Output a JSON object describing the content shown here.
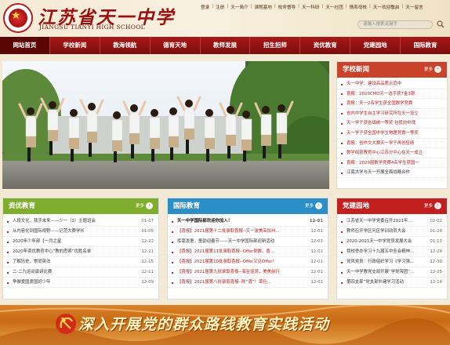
{
  "header": {
    "school_name_cn": "江苏省天一中学",
    "school_name_en": "JIANGSU TIANYI HIGH SCHOOL",
    "top_links": [
      "登录",
      "注册",
      "天一简介",
      "课程基地",
      "校务督导",
      "天一科研",
      "天一社团",
      "情系母校",
      "天一欢迎敬启",
      "天一留言"
    ],
    "search_placeholder": "请输入搜索关键字"
  },
  "nav": {
    "items": [
      "网站首页",
      "学校新闻",
      "教海领航",
      "德育天地",
      "教师发展",
      "招生招师",
      "资优教育",
      "党建园地",
      "国际教育"
    ],
    "active_index": 0
  },
  "slider": {
    "total_dots": 5,
    "active_dot": 4
  },
  "news": {
    "title": "学校新闻",
    "more": "更多",
    "items": [
      "天一中学：建设高品质示范中",
      "喜报：2020CMO天一选手获7金3银",
      "喜报：天一2名学生获全国数学竞赛",
      "省内中学生自主学习研究所在天一设立",
      "天一学子获省级统一等奖 包揽向中瑰",
      "天一学子获全国中学生物理竞赛一等奖",
      "喜报：省作文大赛天一学子再创佳绩",
      "数学组获教育中心江苏分中心在天一成立",
      "喜报：2020届数学竞赛4名学生获国一",
      "江南大学与天一开展全面战略合作"
    ]
  },
  "gifted": {
    "title": "资优教育",
    "more": "更多",
    "items": [
      {
        "text": "人段文化，我手未来——少一（3）主题班会",
        "date": "01-07"
      },
      {
        "text": "从内容化到国际视野——记范大赛学长",
        "date": "01-05"
      },
      {
        "text": "2020年少年部【一月之星",
        "date": "12-22"
      },
      {
        "text": "2020年资优教育中心“教的思索”优胜名单",
        "date": "12-21"
      },
      {
        "text": "了解历史，崇尚英法",
        "date": "12-15"
      },
      {
        "text": "二·二九运动演讲比赛",
        "date": "12-11"
      },
      {
        "text": "争做爱国爱国好少年",
        "date": "12-09"
      }
    ]
  },
  "intl": {
    "title": "国际教育",
    "more": "更多",
    "items": [
      {
        "text": "天一中学国际部欢迎你加入！",
        "date": "12-01",
        "bold": true
      },
      {
        "text": "【喜报】2021届第十二批录取喜报--又一波美高加州...",
        "date": "12-01"
      },
      {
        "text": "挥毫泼墨，墨韵迎春节——天一中学国际部迎新活动",
        "date": "12-01"
      },
      {
        "text": "【喜报】2021届第11批录取喜报--Offer倒数，香...",
        "date": "12-01"
      },
      {
        "text": "【喜报】2021届第10批录取喜报--Offer又见Offer！",
        "date": "12-01"
      },
      {
        "text": "【喜报】2021届第九批录取喜报--海至佳境，美美前行",
        "date": "12-01"
      },
      {
        "text": "【喜报】2021届第八批录取喜报--陈“喜”！荣仕...",
        "date": "12-01"
      }
    ]
  },
  "party": {
    "title": "党建园地",
    "more": "更多",
    "items": [
      {
        "text": "江苏省天一中学党委召开2021年...",
        "date": "02-02"
      },
      {
        "text": "教师召开学区问区学训动员大会",
        "date": "01-20"
      },
      {
        "text": "2020-2021天一中学党员发展大会",
        "date": "01-11"
      },
      {
        "text": "我校举办学习十九届五中全会精神...",
        "date": "12-29"
      },
      {
        "text": "党风党员：行政组织学习《学习强...",
        "date": "12-30"
      },
      {
        "text": "天一中学教党支部开展“学党带团”...",
        "date": "12-25"
      },
      {
        "text": "第四支部“党支部外建学习活动",
        "date": "12-14"
      }
    ]
  },
  "banner": {
    "text": "深入开展党的群众路线教育实践活动"
  },
  "colors": {
    "nav": "#8e1010",
    "news": "#c8432a",
    "gifted": "#7fae2e",
    "intl": "#2b8ec6",
    "party": "#c21f1f"
  }
}
